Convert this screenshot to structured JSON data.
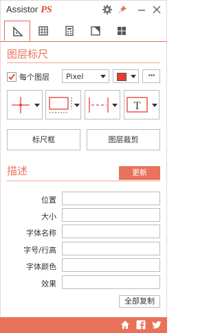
{
  "app": {
    "title": "Assistor",
    "title_suffix": "PS"
  },
  "titlebar_icons": [
    "gear-icon",
    "pin-icon",
    "minimize-icon",
    "close-icon"
  ],
  "tabs": [
    {
      "icon": "ruler-triangle-icon",
      "active": true
    },
    {
      "icon": "grid-icon",
      "active": false
    },
    {
      "icon": "calculator-icon",
      "active": false
    },
    {
      "icon": "slice-icon",
      "active": false
    },
    {
      "icon": "layout-icon",
      "active": false
    }
  ],
  "ruler": {
    "title": "图层标尺",
    "each_layer_label": "每个图层",
    "each_layer_checked": true,
    "unit_value": "Pixel",
    "color_value": "#e63b2e",
    "more_label": "···",
    "tools": [
      "crosshair-tool",
      "rect-border-tool",
      "dash-line-tool",
      "text-tool"
    ],
    "text_tool_glyph": "T",
    "ruler_frame_label": "标尺框",
    "layer_crop_label": "图层裁剪"
  },
  "describe": {
    "title": "描述",
    "refresh_label": "更新",
    "fields": [
      {
        "label": "位置",
        "value": ""
      },
      {
        "label": "大小",
        "value": ""
      },
      {
        "label": "字体名称",
        "value": ""
      },
      {
        "label": "字号/行高",
        "value": ""
      },
      {
        "label": "字体颜色",
        "value": ""
      },
      {
        "label": "效果",
        "value": ""
      }
    ],
    "copy_all_label": "全部复制"
  },
  "footer_icons": [
    "home-icon",
    "facebook-icon",
    "twitter-icon"
  ],
  "colors": {
    "accent": "#e8725a",
    "accent_dark": "#e46a4f"
  }
}
